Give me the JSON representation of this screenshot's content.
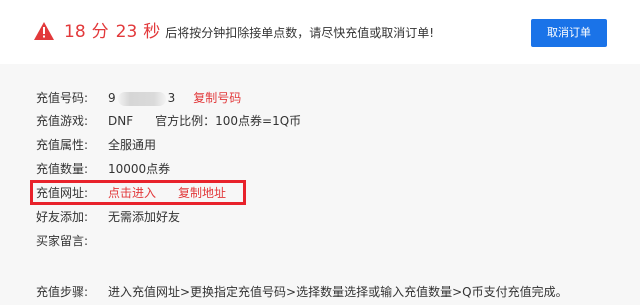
{
  "header": {
    "countdown": {
      "minutes": "18",
      "minutes_unit": "分",
      "seconds": "23",
      "seconds_unit": "秒"
    },
    "message": "后将按分钟扣除接单点数，请尽快充值或取消订单!",
    "cancel_button": "取消订单"
  },
  "details": {
    "number": {
      "label": "充值号码:",
      "value_prefix": "9",
      "value_suffix": "3",
      "copy": "复制号码"
    },
    "game": {
      "label": "充值游戏:",
      "value": "DNF",
      "ratio": "官方比例：100点券=1Q币"
    },
    "attribute": {
      "label": "充值属性:",
      "value": "全服通用"
    },
    "quantity": {
      "label": "充值数量:",
      "value": "10000点券"
    },
    "url": {
      "label": "充值网址:",
      "enter": "点击进入",
      "copy": "复制地址"
    },
    "friend": {
      "label": "好友添加:",
      "value": "无需添加好友"
    },
    "message": {
      "label": "买家留言:",
      "value": ""
    },
    "steps": {
      "label": "充值步骤:",
      "value": "进入充值网址>更换指定充值号码>选择数量选择或输入充值数量>Q币支付充值完成。"
    }
  },
  "colors": {
    "accent_red": "#e2393b",
    "button_blue": "#1a73e8",
    "highlight": "#e8222b"
  }
}
